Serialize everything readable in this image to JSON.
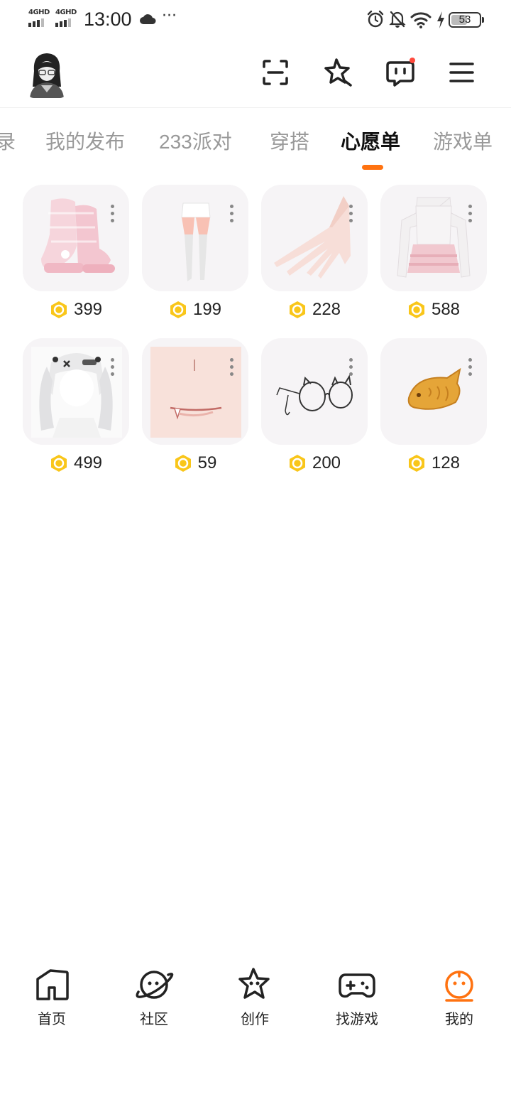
{
  "status_bar": {
    "signal1": "4GHD",
    "signal2": "4GHD",
    "time": "13:00",
    "more": "···",
    "battery": "53"
  },
  "header": {
    "avatar_icon": "avatar",
    "actions": [
      "scan-icon",
      "star-icon",
      "message-icon",
      "menu-icon"
    ],
    "accent_color": "#ff7210"
  },
  "tabs": [
    {
      "label": "录"
    },
    {
      "label": "我的发布"
    },
    {
      "label": "233派对"
    },
    {
      "label": "穿搭"
    },
    {
      "label": "心愿单",
      "active": true
    },
    {
      "label": "游戏单"
    }
  ],
  "items": [
    {
      "name": "pink boots",
      "price": "399"
    },
    {
      "name": "stockings",
      "price": "199"
    },
    {
      "name": "gloves",
      "price": "228"
    },
    {
      "name": "white dress",
      "price": "588"
    },
    {
      "name": "white twin-tail hair",
      "price": "499"
    },
    {
      "name": "fang mouth",
      "price": "59"
    },
    {
      "name": "cat glasses",
      "price": "200"
    },
    {
      "name": "taiyaki",
      "price": "128"
    }
  ],
  "bottom_nav": [
    {
      "label": "首页",
      "icon": "home-icon"
    },
    {
      "label": "社区",
      "icon": "planet-icon"
    },
    {
      "label": "创作",
      "icon": "create-star-icon"
    },
    {
      "label": "找游戏",
      "icon": "gamepad-icon"
    },
    {
      "label": "我的",
      "icon": "profile-icon",
      "active": true
    }
  ]
}
